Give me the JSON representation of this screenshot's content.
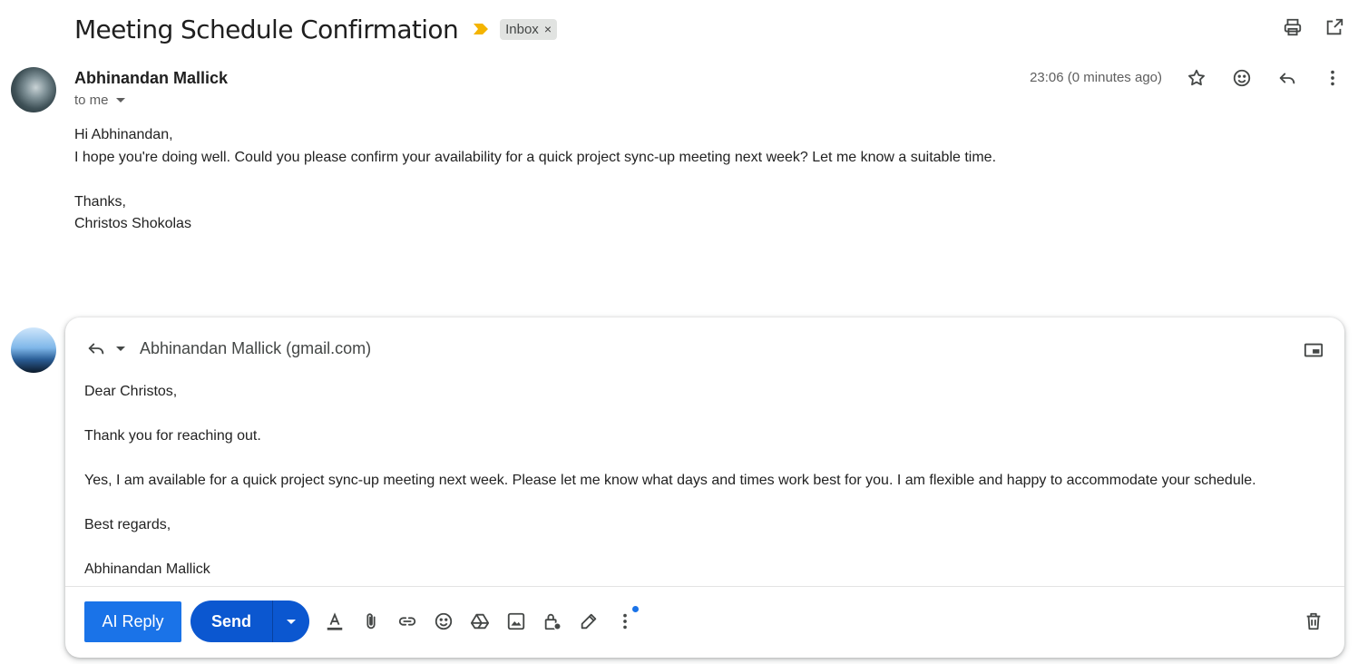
{
  "subject": "Meeting Schedule Confirmation",
  "label": "Inbox",
  "label_remove": "×",
  "message": {
    "sender": "Abhinandan Mallick",
    "recipient": "to me",
    "timestamp": "23:06 (0 minutes ago)",
    "body": [
      "Hi Abhinandan,",
      "I hope you're doing well. Could you please confirm your availability for a quick project sync-up meeting next week? Let me know a suitable time.",
      "",
      "Thanks,",
      "Christos Shokolas"
    ]
  },
  "reply": {
    "to": "Abhinandan Mallick (gmail.com)",
    "paragraphs": [
      "Dear Christos,",
      "Thank you for reaching out.",
      "Yes, I am available for a quick project sync-up meeting next week. Please let me know what days and times work best for you. I am flexible and happy to accommodate your schedule.",
      "Best regards,",
      "Abhinandan Mallick"
    ],
    "ai_reply_label": "AI Reply",
    "send_label": "Send"
  },
  "icons": {
    "top": [
      "print-icon",
      "open-in-new-window-icon"
    ],
    "message": [
      "star-icon",
      "emoji-reaction-icon",
      "reply-icon",
      "more-vert-icon"
    ],
    "toolbar": [
      "format-text-icon",
      "attach-icon",
      "link-icon",
      "emoji-icon",
      "drive-icon",
      "photo-icon",
      "confidential-lock-icon",
      "signature-pen-icon",
      "more-options-icon",
      "trash-icon"
    ]
  },
  "colors": {
    "accent": "#1a73e8",
    "send": "#0b57d0",
    "importance": "#f4b400",
    "chip": "#e1e3e1"
  }
}
